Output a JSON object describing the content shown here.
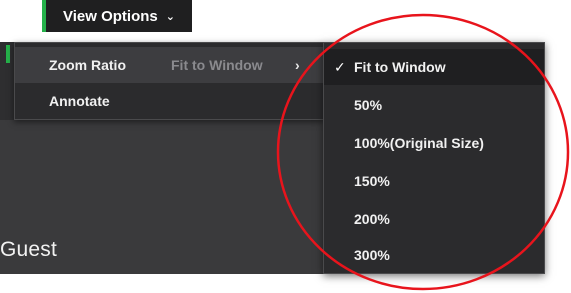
{
  "toolbar": {
    "view_options_label": "View Options",
    "chevron_icon": "chevron-down-icon",
    "accent_color": "#25b14a"
  },
  "stage": {
    "participant_name": "Guest"
  },
  "menu": {
    "items": [
      {
        "label": "Zoom Ratio",
        "value": "Fit to Window",
        "arrow": "›"
      },
      {
        "label": "Annotate"
      }
    ]
  },
  "zoom_submenu": {
    "selected": "Fit to Window",
    "options": [
      {
        "label": "Fit to Window",
        "checked": true
      },
      {
        "label": "50%"
      },
      {
        "label": "100%(Original Size)"
      },
      {
        "label": "150%"
      },
      {
        "label": "200%"
      },
      {
        "label": "300%"
      }
    ]
  },
  "annotation_color": "#e8141c"
}
